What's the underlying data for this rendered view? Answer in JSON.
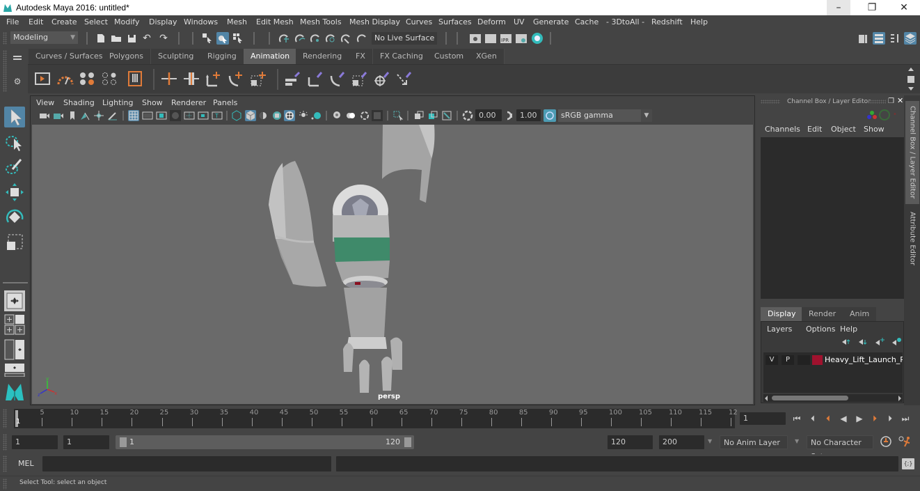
{
  "window": {
    "title": "Autodesk Maya 2016: untitled*",
    "minimize": "–",
    "maximize": "❐",
    "close": "✕"
  },
  "menubar": {
    "items": [
      "File",
      "Edit",
      "Create",
      "Select",
      "Modify",
      "Display",
      "Windows",
      "Mesh",
      "Edit Mesh",
      "Mesh Tools",
      "Mesh Display",
      "Curves",
      "Surfaces",
      "Deform",
      "UV",
      "Generate",
      "Cache",
      "- 3DtoAll -",
      "Redshift",
      "Help"
    ]
  },
  "statusline": {
    "menuset": "Modeling",
    "live_surface": "No Live Surface"
  },
  "shelf": {
    "tabs": [
      "Curves / Surfaces",
      "Polygons",
      "Sculpting",
      "Rigging",
      "Animation",
      "Rendering",
      "FX",
      "FX Caching",
      "Custom",
      "XGen"
    ],
    "active_tab": "Animation"
  },
  "viewport": {
    "menu": [
      "View",
      "Shading",
      "Lighting",
      "Show",
      "Renderer",
      "Panels"
    ],
    "exposure": "0.00",
    "gamma": "1.00",
    "color_space": "sRGB gamma",
    "camera": "persp"
  },
  "channel_box": {
    "title": "Channel Box / Layer Editor",
    "menu": [
      "Channels",
      "Edit",
      "Object",
      "Show"
    ],
    "layer_tabs": [
      "Display",
      "Render",
      "Anim"
    ],
    "active_layer_tab": "Display",
    "layer_menu": [
      "Layers",
      "Options",
      "Help"
    ],
    "layers": [
      {
        "visible": "V",
        "playback": "P",
        "name": "Heavy_Lift_Launch_Ro",
        "color": "#a0122e"
      }
    ]
  },
  "side_tabs": [
    "Channel Box / Layer Editor",
    "Attribute Editor"
  ],
  "timeslider": {
    "ticks": [
      5,
      10,
      15,
      20,
      25,
      30,
      35,
      40,
      45,
      50,
      55,
      60,
      65,
      70,
      75,
      80,
      85,
      90,
      95,
      100,
      105,
      110,
      115,
      12
    ],
    "current_frame_marker": "1",
    "current_frame": "1",
    "playback_buttons": [
      "go-to-start",
      "step-back-key",
      "step-back-frame",
      "play-backward",
      "play-forward",
      "step-forward-frame",
      "step-forward-key",
      "go-to-end"
    ]
  },
  "range": {
    "start_time": "1",
    "playback_start": "1",
    "slider_start": "1",
    "slider_end": "120",
    "playback_end": "120",
    "end_time": "200",
    "anim_layer": "No Anim Layer",
    "character_set": "No Character Set"
  },
  "command": {
    "language": "MEL",
    "input": "",
    "output": ""
  },
  "helpline": {
    "text": "Select Tool: select an object"
  },
  "colors": {
    "accent": "#5285a6",
    "layer_color": "#a0122e",
    "key_orange": "#e07b39"
  }
}
